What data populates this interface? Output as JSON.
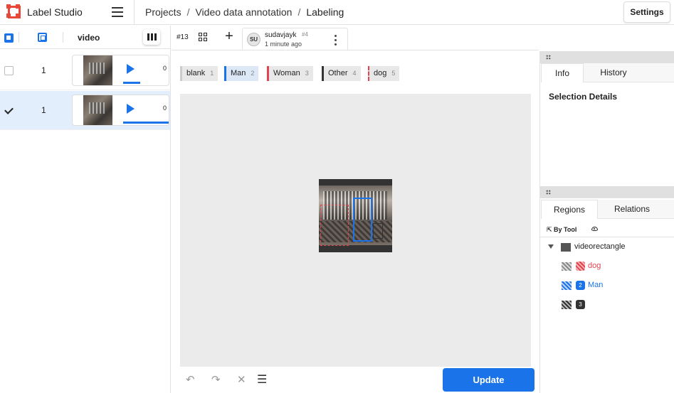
{
  "header": {
    "app_title": "Label Studio",
    "breadcrumb": [
      "Projects",
      "Video data annotation",
      "Labeling"
    ],
    "settings_label": "Settings"
  },
  "tasks": {
    "column_label": "video",
    "rows": [
      {
        "id": "1",
        "selected": false,
        "time": "0",
        "progress": 0.3
      },
      {
        "id": "1",
        "selected": true,
        "time": "0",
        "progress": 1.0
      }
    ]
  },
  "annotation": {
    "task_number": "#13",
    "user_initials": "SU",
    "user": "sudavjayk",
    "annotation_id": "#4",
    "time_ago": "1 minute ago"
  },
  "labels": [
    {
      "name": "blank",
      "hotkey": "1",
      "color": "#cccccc"
    },
    {
      "name": "Man",
      "hotkey": "2",
      "color": "#1a73e8"
    },
    {
      "name": "Woman",
      "hotkey": "3",
      "color": "#e0444e"
    },
    {
      "name": "Other",
      "hotkey": "4",
      "color": "#333333"
    },
    {
      "name": "dog",
      "hotkey": "5",
      "color": "#e0444e"
    }
  ],
  "bottom_bar": {
    "undo_icon": "undo-icon",
    "redo_icon": "redo-icon",
    "reset_icon": "close-icon",
    "settings_icon": "sliders-icon",
    "update_label": "Update"
  },
  "side_panel": {
    "top_tabs": [
      "Info",
      "History"
    ],
    "selection_title": "Selection Details",
    "bottom_tabs": [
      "Regions",
      "Relations"
    ],
    "group_by_label": "By Tool",
    "tool_name": "videorectangle",
    "regions": [
      {
        "label": "dog",
        "badge": "",
        "color": "#e0444e"
      },
      {
        "label": "Man",
        "badge": "2",
        "color": "#1a73e8"
      },
      {
        "label": "",
        "badge": "3",
        "color": "#333333"
      }
    ]
  }
}
